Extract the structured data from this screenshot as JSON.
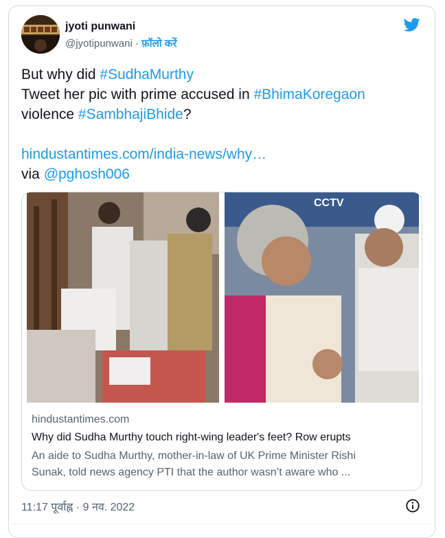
{
  "tweet": {
    "author_name": "jyoti punwani",
    "handle": "@jyotipunwani",
    "dot": " · ",
    "follow_label": "फ़ॉलो करें",
    "text_line1_prefix": "But why did ",
    "hashtag1": "#SudhaMurthy",
    "text_line2_prefix": "Tweet her pic with prime accused in ",
    "hashtag2": "#BhimaKoregaon",
    "text_line3_prefix": "violence ",
    "hashtag3": "#SambhajiBhide",
    "text_line3_suffix": "?",
    "url": "hindustantimes.com/india-news/why…",
    "via_label": "via ",
    "via_mention": "@pghosh006",
    "timestamp": "11:17 पूर्वाह्न · 9 नव. 2022"
  },
  "card": {
    "domain": "hindustantimes.com",
    "title": "Why did Sudha Murthy touch right-wing leader's feet? Row erupts",
    "description": "An aide to Sudha Murthy, mother-in-law of UK Prime Minister Rishi Sunak, told news agency PTI that the author wasn’t aware who ...",
    "image_sign_text": "CCTV"
  },
  "icons": {
    "brand": "twitter-bird-icon",
    "info": "info-icon"
  },
  "colors": {
    "accent": "#1d9bf0",
    "text": "#0f1419",
    "muted": "#536471",
    "border": "#cfd9de"
  }
}
